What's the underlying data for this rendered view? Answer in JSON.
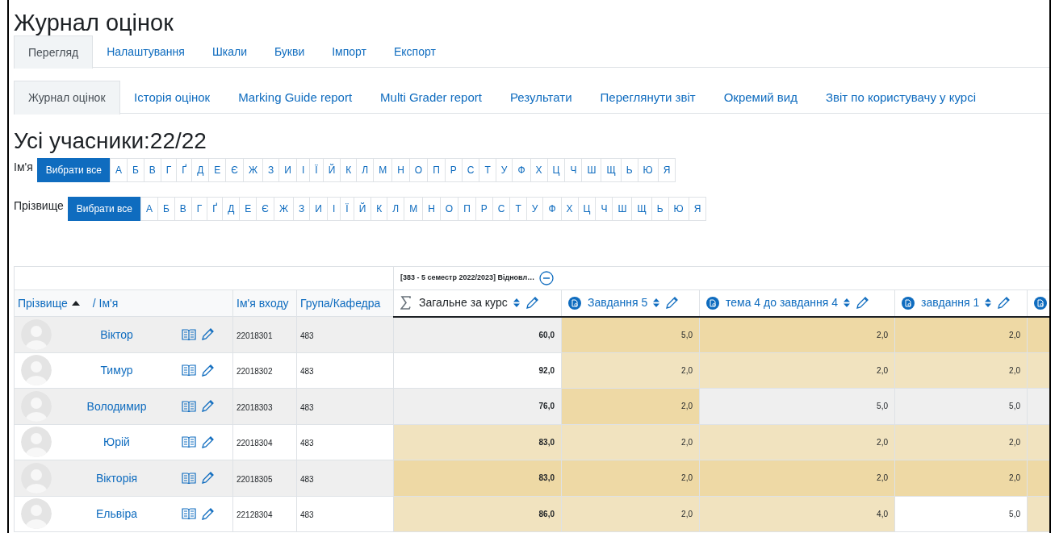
{
  "page_title": "Журнал оцінок",
  "main_tabs": [
    {
      "label": "Перегляд",
      "selected": true
    },
    {
      "label": "Налаштування",
      "selected": false
    },
    {
      "label": "Шкали",
      "selected": false
    },
    {
      "label": "Букви",
      "selected": false
    },
    {
      "label": "Імпорт",
      "selected": false
    },
    {
      "label": "Експорт",
      "selected": false
    }
  ],
  "report_tabs": [
    {
      "label": "Журнал оцінок",
      "selected": true
    },
    {
      "label": "Історія оцінок",
      "selected": false
    },
    {
      "label": "Marking Guide report",
      "selected": false
    },
    {
      "label": "Multi Grader report",
      "selected": false
    },
    {
      "label": "Результати",
      "selected": false
    },
    {
      "label": "Переглянути звіт",
      "selected": false
    },
    {
      "label": "Окремий вид",
      "selected": false
    },
    {
      "label": "Звіт по користувачу у курсі",
      "selected": false
    }
  ],
  "participants_heading": "Усі учасники:22/22",
  "initials_filters": [
    {
      "label": "Ім'я",
      "items": [
        {
          "text": "Вибрати все",
          "selected": true
        },
        {
          "text": "А",
          "selected": false
        },
        {
          "text": "Б",
          "selected": false
        },
        {
          "text": "В",
          "selected": false
        },
        {
          "text": "Г",
          "selected": false
        },
        {
          "text": "Ґ",
          "selected": false
        },
        {
          "text": "Д",
          "selected": false
        },
        {
          "text": "Е",
          "selected": false
        },
        {
          "text": "Є",
          "selected": false
        },
        {
          "text": "Ж",
          "selected": false
        },
        {
          "text": "З",
          "selected": false
        },
        {
          "text": "И",
          "selected": false
        },
        {
          "text": "І",
          "selected": false
        },
        {
          "text": "Ї",
          "selected": false
        },
        {
          "text": "Й",
          "selected": false
        },
        {
          "text": "К",
          "selected": false
        },
        {
          "text": "Л",
          "selected": false
        },
        {
          "text": "М",
          "selected": false
        },
        {
          "text": "Н",
          "selected": false
        },
        {
          "text": "О",
          "selected": false
        },
        {
          "text": "П",
          "selected": false
        },
        {
          "text": "Р",
          "selected": false
        },
        {
          "text": "С",
          "selected": false
        },
        {
          "text": "Т",
          "selected": false
        },
        {
          "text": "У",
          "selected": false
        },
        {
          "text": "Ф",
          "selected": false
        },
        {
          "text": "Х",
          "selected": false
        },
        {
          "text": "Ц",
          "selected": false
        },
        {
          "text": "Ч",
          "selected": false
        },
        {
          "text": "Ш",
          "selected": false
        },
        {
          "text": "Щ",
          "selected": false
        },
        {
          "text": "Ь",
          "selected": false
        },
        {
          "text": "Ю",
          "selected": false
        },
        {
          "text": "Я",
          "selected": false
        }
      ]
    },
    {
      "label": "Прізвище",
      "items": [
        {
          "text": "Вибрати все",
          "selected": true
        },
        {
          "text": "А",
          "selected": false
        },
        {
          "text": "Б",
          "selected": false
        },
        {
          "text": "В",
          "selected": false
        },
        {
          "text": "Г",
          "selected": false
        },
        {
          "text": "Ґ",
          "selected": false
        },
        {
          "text": "Д",
          "selected": false
        },
        {
          "text": "Е",
          "selected": false
        },
        {
          "text": "Є",
          "selected": false
        },
        {
          "text": "Ж",
          "selected": false
        },
        {
          "text": "З",
          "selected": false
        },
        {
          "text": "И",
          "selected": false
        },
        {
          "text": "І",
          "selected": false
        },
        {
          "text": "Ї",
          "selected": false
        },
        {
          "text": "Й",
          "selected": false
        },
        {
          "text": "К",
          "selected": false
        },
        {
          "text": "Л",
          "selected": false
        },
        {
          "text": "М",
          "selected": false
        },
        {
          "text": "Н",
          "selected": false
        },
        {
          "text": "О",
          "selected": false
        },
        {
          "text": "П",
          "selected": false
        },
        {
          "text": "Р",
          "selected": false
        },
        {
          "text": "С",
          "selected": false
        },
        {
          "text": "Т",
          "selected": false
        },
        {
          "text": "У",
          "selected": false
        },
        {
          "text": "Ф",
          "selected": false
        },
        {
          "text": "Х",
          "selected": false
        },
        {
          "text": "Ц",
          "selected": false
        },
        {
          "text": "Ч",
          "selected": false
        },
        {
          "text": "Ш",
          "selected": false
        },
        {
          "text": "Щ",
          "selected": false
        },
        {
          "text": "Ь",
          "selected": false
        },
        {
          "text": "Ю",
          "selected": false
        },
        {
          "text": "Я",
          "selected": false
        }
      ]
    }
  ],
  "grader": {
    "category_header": "[383 - 5 семестр 2022/2023] Відновл…",
    "name_header": {
      "surname": "Прізвище",
      "first": "/ Ім'я"
    },
    "user_columns": [
      "Ім'я входу",
      "Група/Кафедра"
    ],
    "grade_columns": [
      {
        "kind": "total",
        "title": "Загальне за курс"
      },
      {
        "kind": "assignment",
        "title": "Завдання 5"
      },
      {
        "kind": "assignment",
        "title": "тема 4 до завдання 4"
      },
      {
        "kind": "assignment",
        "title": "завдання 1"
      },
      {
        "kind": "assignment"
      }
    ],
    "rows": [
      {
        "name": "Віктор",
        "login": "22018301",
        "group": "483",
        "grades": [
          {
            "value": "60,0",
            "overridden": false
          },
          {
            "value": "5,0",
            "overridden": true
          },
          {
            "value": "2,0",
            "overridden": true
          },
          {
            "value": "2,0",
            "overridden": true
          },
          {
            "overridden": true
          }
        ]
      },
      {
        "name": "Тимур",
        "login": "22018302",
        "group": "483",
        "grades": [
          {
            "value": "92,0",
            "overridden": false
          },
          {
            "value": "2,0",
            "overridden": true
          },
          {
            "value": "2,0",
            "overridden": true
          },
          {
            "value": "2,0",
            "overridden": true
          },
          {
            "overridden": true
          }
        ]
      },
      {
        "name": "Володимир",
        "login": "22018303",
        "group": "483",
        "grades": [
          {
            "value": "76,0",
            "overridden": false
          },
          {
            "value": "2,0",
            "overridden": true
          },
          {
            "value": "5,0",
            "overridden": false
          },
          {
            "value": "5,0",
            "overridden": false
          },
          {
            "overridden": false
          }
        ]
      },
      {
        "name": "Юрій",
        "login": "22018304",
        "group": "483",
        "grades": [
          {
            "value": "83,0",
            "overridden": true
          },
          {
            "value": "2,0",
            "overridden": true
          },
          {
            "value": "2,0",
            "overridden": true
          },
          {
            "value": "2,0",
            "overridden": true
          },
          {
            "overridden": true
          }
        ]
      },
      {
        "name": "Вікторія",
        "login": "22018305",
        "group": "483",
        "grades": [
          {
            "value": "83,0",
            "overridden": true
          },
          {
            "value": "2,0",
            "overridden": true
          },
          {
            "value": "2,0",
            "overridden": true
          },
          {
            "value": "2,0",
            "overridden": true
          },
          {
            "overridden": true
          }
        ]
      },
      {
        "name": "Ельвіра",
        "login": "22128304",
        "group": "483",
        "grades": [
          {
            "value": "86,0",
            "overridden": true
          },
          {
            "value": "2,0",
            "overridden": true
          },
          {
            "value": "4,0",
            "overridden": true
          },
          {
            "value": "5,0",
            "overridden": false
          },
          {
            "overridden": true
          }
        ]
      }
    ]
  }
}
